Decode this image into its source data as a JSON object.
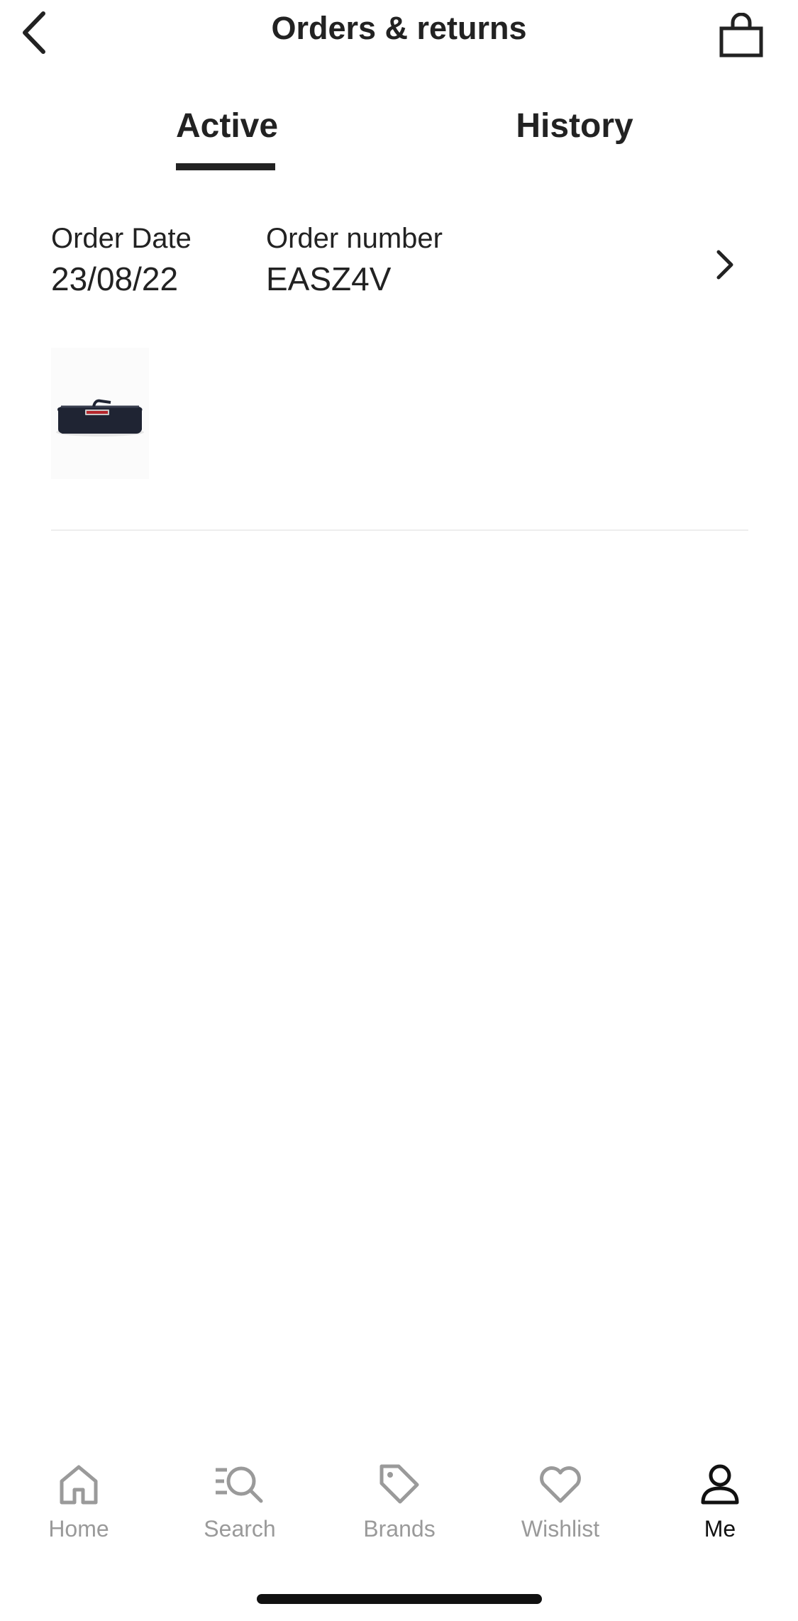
{
  "header": {
    "title": "Orders & returns"
  },
  "tabs": [
    {
      "label": "Active",
      "selected": true
    },
    {
      "label": "History",
      "selected": false
    }
  ],
  "order": {
    "date_label": "Order Date",
    "date_value": "23/08/22",
    "number_label": "Order number",
    "number_value": "EASZ4V",
    "thumbnail_icon": "pencil-case-product-image"
  },
  "bottom_nav": [
    {
      "label": "Home",
      "icon": "home-icon",
      "active": false
    },
    {
      "label": "Search",
      "icon": "search-icon",
      "active": false
    },
    {
      "label": "Brands",
      "icon": "tag-icon",
      "active": false
    },
    {
      "label": "Wishlist",
      "icon": "heart-icon",
      "active": false
    },
    {
      "label": "Me",
      "icon": "user-icon",
      "active": true
    }
  ],
  "colors": {
    "text": "#222222",
    "inactive_nav": "#9a9a9a",
    "divider": "#eeeeee"
  }
}
